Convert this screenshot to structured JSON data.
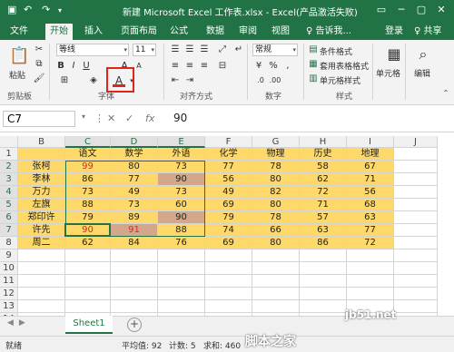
{
  "titlebar": {
    "save_icon": "save-icon",
    "undo_icon": "undo-icon",
    "redo_icon": "redo-icon",
    "title": "新建 Microsoft Excel 工作表.xlsx - Excel(产品激活失败)",
    "minimize": "─",
    "restore": "▢",
    "close": "✕",
    "restore_ribbon": "▭"
  },
  "tabs": [
    "文件",
    "开始",
    "插入",
    "页面布局",
    "公式",
    "数据",
    "审阅",
    "视图",
    "♀ 告诉我..."
  ],
  "tabs_right": {
    "login": "登录",
    "share": "♀ 共享"
  },
  "ribbon": {
    "clipboard": {
      "paste": "粘贴",
      "label": "剪贴板"
    },
    "font": {
      "name": "等线",
      "size": "11",
      "bold": "B",
      "italic": "I",
      "underline": "U",
      "grow": "A",
      "shrink": "A",
      "font_color": "A",
      "label": "字体"
    },
    "alignment": {
      "label": "对齐方式"
    },
    "number": {
      "format": "常规",
      "percent": "%",
      "comma": ",",
      "label": "数字"
    },
    "styles": {
      "conditional": "条件格式",
      "table": "套用表格格式",
      "cell_styles": "单元格样式",
      "label": "样式"
    },
    "cells": {
      "label": "单元格"
    },
    "editing": {
      "label": "编辑"
    }
  },
  "formula_bar": {
    "name_box": "C7",
    "cancel": "✕",
    "enter": "✓",
    "fx": "fx",
    "value": "90"
  },
  "columns": [
    "B",
    "C",
    "D",
    "E",
    "F",
    "G",
    "H",
    "I",
    "J"
  ],
  "rows": [
    "1",
    "2",
    "3",
    "4",
    "5",
    "6",
    "7",
    "8",
    "9",
    "10",
    "11",
    "12",
    "13",
    "14"
  ],
  "table": {
    "headers": [
      "",
      "语文",
      "数学",
      "外语",
      "化学",
      "物理",
      "历史",
      "地理"
    ],
    "data": [
      [
        "张柯",
        "99",
        "80",
        "73",
        "77",
        "78",
        "58",
        "67"
      ],
      [
        "李林",
        "86",
        "77",
        "90",
        "56",
        "80",
        "62",
        "71"
      ],
      [
        "万力",
        "73",
        "49",
        "73",
        "49",
        "82",
        "72",
        "56"
      ],
      [
        "左旗",
        "88",
        "73",
        "60",
        "69",
        "80",
        "71",
        "68"
      ],
      [
        "郑印许",
        "79",
        "89",
        "90",
        "79",
        "78",
        "57",
        "63"
      ],
      [
        "许先",
        "90",
        "91",
        "88",
        "74",
        "66",
        "63",
        "77"
      ],
      [
        "周二",
        "62",
        "84",
        "76",
        "69",
        "80",
        "86",
        "72"
      ]
    ]
  },
  "sheet": {
    "tab": "Sheet1",
    "add": "+"
  },
  "status": {
    "ready": "就绪",
    "average": "平均值: 92",
    "count": "计数: 5",
    "sum": "求和: 460"
  },
  "watermark": {
    "site": "jb51.net",
    "text": "脚本之家"
  },
  "colors": {
    "accent": "#217346",
    "highlight_fill": "#fed96a",
    "cell_highlight": "#d3a88a",
    "red_text": "#d9262b",
    "red_box": "#e0241b"
  }
}
